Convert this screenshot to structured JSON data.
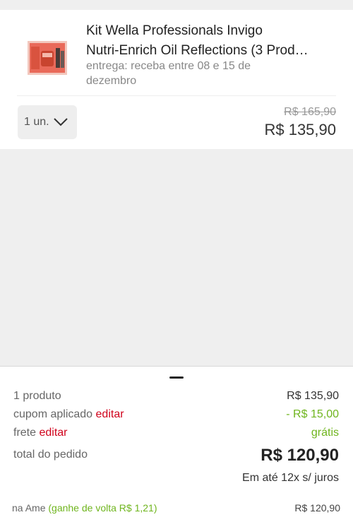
{
  "colors": {
    "accent_red": "#d0021b",
    "accent_green": "#6fb51e",
    "product_box": "#e96a5a"
  },
  "product": {
    "title_line1": "Kit Wella Professionals Invigo",
    "title_line2": "Nutri-Enrich Oil Reflections (3 Prod…",
    "delivery_line1": "entrega: receba entre 08 e 15 de",
    "delivery_line2": "dezembro",
    "quantity_label": "1 un.",
    "old_price": "R$ 165,90",
    "price": "R$ 135,90"
  },
  "summary": {
    "products_label": "1 produto",
    "products_amount": "R$ 135,90",
    "coupon_label": "cupom aplicado",
    "coupon_edit": "editar",
    "coupon_amount": "- R$ 15,00",
    "shipping_label": "frete",
    "shipping_edit": "editar",
    "shipping_amount": "grátis",
    "total_label": "total do pedido",
    "total_amount": "R$ 120,90",
    "installments": "Em até 12x s/ juros",
    "ame_label": "na Ame",
    "ame_cashback": "(ganhe de volta R$ 1,21)",
    "ame_amount": "R$ 120,90"
  }
}
